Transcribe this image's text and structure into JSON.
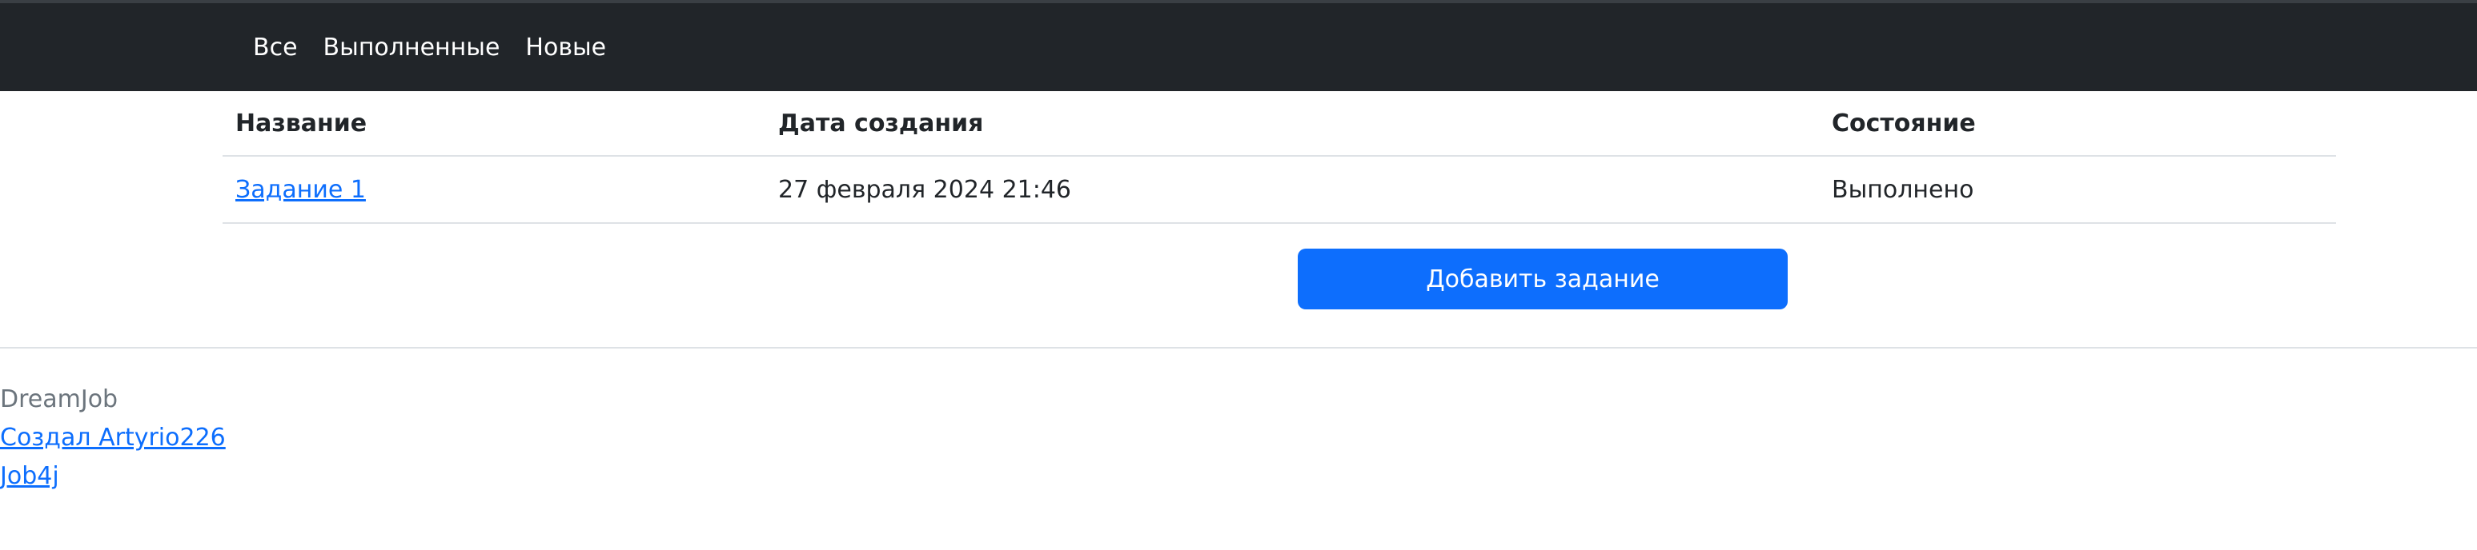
{
  "nav": {
    "items": [
      {
        "label": "Все"
      },
      {
        "label": "Выполненные"
      },
      {
        "label": "Новые"
      }
    ]
  },
  "table": {
    "headers": {
      "name": "Название",
      "created": "Дата создания",
      "status": "Состояние"
    },
    "rows": [
      {
        "name": "Задание 1",
        "created": "27 февраля 2024 21:46",
        "status": "Выполнено"
      }
    ]
  },
  "actions": {
    "add_task_label": "Добавить задание"
  },
  "footer": {
    "brand": "DreamJob",
    "author_link": "Создал Artyrio226",
    "project_link": "Job4j"
  },
  "colors": {
    "navbar_bg": "#212529",
    "primary": "#0d6efd",
    "muted": "#6c757d"
  }
}
